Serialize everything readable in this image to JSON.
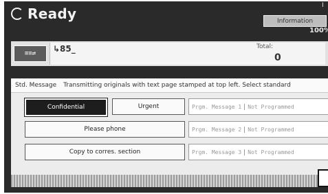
{
  "status": {
    "title": "Ready"
  },
  "header": {
    "info_button": "Information",
    "memory": "100%",
    "corner": "I"
  },
  "dest": {
    "mode_icon": "≡≡⇄",
    "phone": "↳85_",
    "total_label": "Total:",
    "total_value": "0"
  },
  "panel": {
    "tab": "Std. Message",
    "instructions": "Transmitting originals with text page stamped at top left. Select standard"
  },
  "buttons": {
    "confidential": "Confidential",
    "urgent": "Urgent",
    "please_phone": "Please phone",
    "copy_to": "Copy to corres. section"
  },
  "slots": [
    {
      "label": "Prgm. Message 1",
      "status": "Not Programmed"
    },
    {
      "label": "Prgm. Message 2",
      "status": "Not Programmed"
    },
    {
      "label": "Prgm. Message 3",
      "status": "Not Programmed"
    }
  ]
}
